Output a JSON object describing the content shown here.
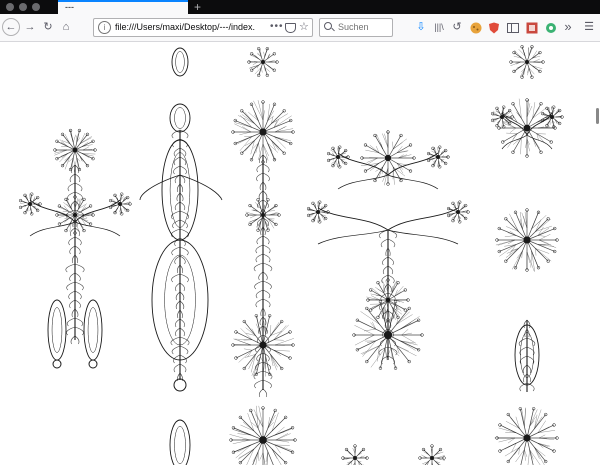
{
  "tab": {
    "title": "---"
  },
  "newtab": {
    "glyph": "+"
  },
  "toolbar": {
    "back_glyph": "←",
    "forward_glyph": "→",
    "reload_glyph": "↻",
    "home_glyph": "⌂",
    "url": "file:///Users/maxi/Desktop/---/index.",
    "page_actions_glyph": "•••",
    "bookmark_glyph": "☆",
    "search_placeholder": "Suchen",
    "download_glyph": "⇩",
    "library_glyph": "|||\\",
    "history_glyph": "↺",
    "overflow_glyph": "»",
    "menu_glyph": "☰"
  },
  "colors": {
    "accent": "#0a84ff",
    "chrome_dark": "#0c0c0d",
    "toolbar": "#f9f9fa",
    "ink": "#1a1a1a"
  }
}
